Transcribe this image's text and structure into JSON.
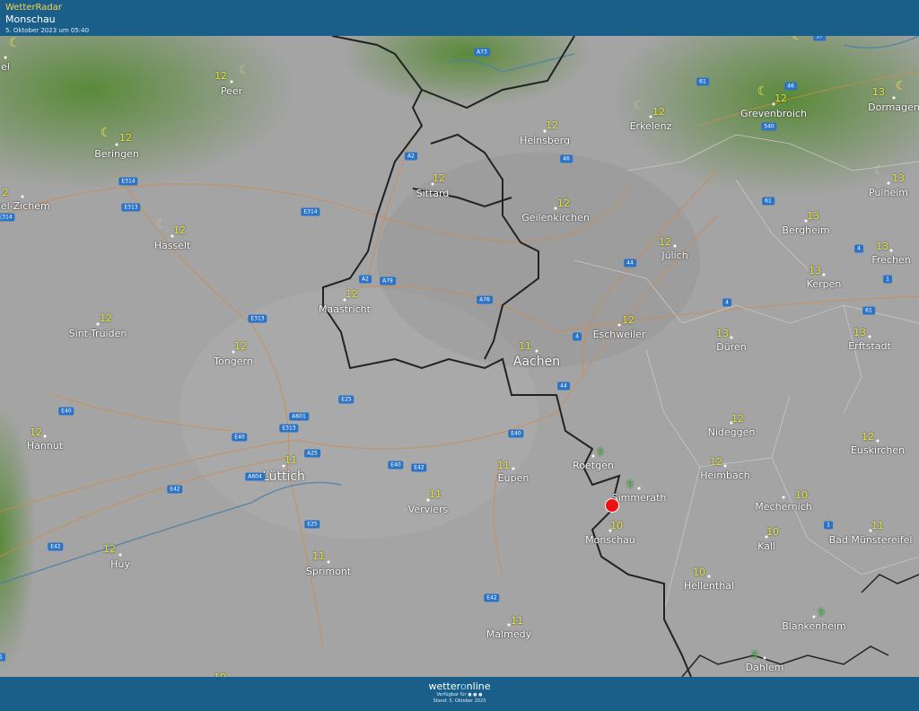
{
  "header": {
    "brand": "WetterRadar",
    "place": "Monschau",
    "date": "5. Oktober 2023 um 05:40"
  },
  "footer": {
    "logo_a": "wetter",
    "logo_b": "o",
    "logo_c": "nline",
    "available": "Verfügbar für",
    "stand": "Stand: 5. Oktober 2023"
  },
  "colors": {
    "header": "#1a5f8a",
    "temp": "#e6e62a",
    "cold": "#4ed14e",
    "road": "#2a73c6",
    "pin": "#e11111"
  },
  "cities": [
    {
      "name": "Beringen",
      "temp": "12"
    },
    {
      "name": "Peer",
      "temp": "12"
    },
    {
      "name": "vel-Zichem",
      "temp": "2"
    },
    {
      "name": "Hasselt",
      "temp": "12"
    },
    {
      "name": "Sint-Truiden",
      "temp": "12"
    },
    {
      "name": "Tongern",
      "temp": "12"
    },
    {
      "name": "Hannut",
      "temp": "12"
    },
    {
      "name": "Huy",
      "temp": "12"
    },
    {
      "name": "Lüttich",
      "temp": "11"
    },
    {
      "name": "Sprimont",
      "temp": "11"
    },
    {
      "name": "Verviers",
      "temp": "11"
    },
    {
      "name": "Eupen",
      "temp": "11"
    },
    {
      "name": "Malmedy",
      "temp": "11"
    },
    {
      "name": "Maastricht",
      "temp": "12"
    },
    {
      "name": "Sittard",
      "temp": "12"
    },
    {
      "name": "Heinsberg",
      "temp": "12"
    },
    {
      "name": "Geilenkirchen",
      "temp": "12"
    },
    {
      "name": "Erkelenz",
      "temp": "12"
    },
    {
      "name": "Aachen",
      "temp": "11"
    },
    {
      "name": "Eschweiler",
      "temp": "12"
    },
    {
      "name": "Jülich",
      "temp": "12"
    },
    {
      "name": "Roetgen",
      "temp": "9"
    },
    {
      "name": "Simmerath",
      "temp": "9"
    },
    {
      "name": "Monschau",
      "temp": "10"
    },
    {
      "name": "Hellenthal",
      "temp": "10"
    },
    {
      "name": "Heimbach",
      "temp": "12"
    },
    {
      "name": "Nideggen",
      "temp": "12"
    },
    {
      "name": "Düren",
      "temp": "13"
    },
    {
      "name": "Grevenbroich",
      "temp": "12"
    },
    {
      "name": "Dormagen",
      "temp": "13"
    },
    {
      "name": "Pulheim",
      "temp": "13"
    },
    {
      "name": "Bergheim",
      "temp": "13"
    },
    {
      "name": "Frechen",
      "temp": "13"
    },
    {
      "name": "Kerpen",
      "temp": "13"
    },
    {
      "name": "Erftstadt",
      "temp": "13"
    },
    {
      "name": "Euskirchen",
      "temp": "12"
    },
    {
      "name": "Mechernich",
      "temp": "10"
    },
    {
      "name": "Kall",
      "temp": "10"
    },
    {
      "name": "Bad Münstereifel",
      "temp": "11"
    },
    {
      "name": "Blankenheim",
      "temp": "9"
    },
    {
      "name": "Dahlem",
      "temp": "9"
    },
    {
      "name": "",
      "temp": "10"
    },
    {
      "name": "el",
      "temp": ""
    }
  ],
  "roads": [
    "A73",
    "A2",
    "E314",
    "E313",
    "E314",
    "A2",
    "A79",
    "A76",
    "E313",
    "E25",
    "A601",
    "E313",
    "E40",
    "E40",
    "A25",
    "A604",
    "E42",
    "E40",
    "E42",
    "E40",
    "E25",
    "E42",
    "E42",
    "E314",
    "44",
    "44",
    "4",
    "4",
    "61",
    "46",
    "540",
    "57",
    "61",
    "4",
    "1",
    "1",
    "46",
    "1",
    "61"
  ]
}
